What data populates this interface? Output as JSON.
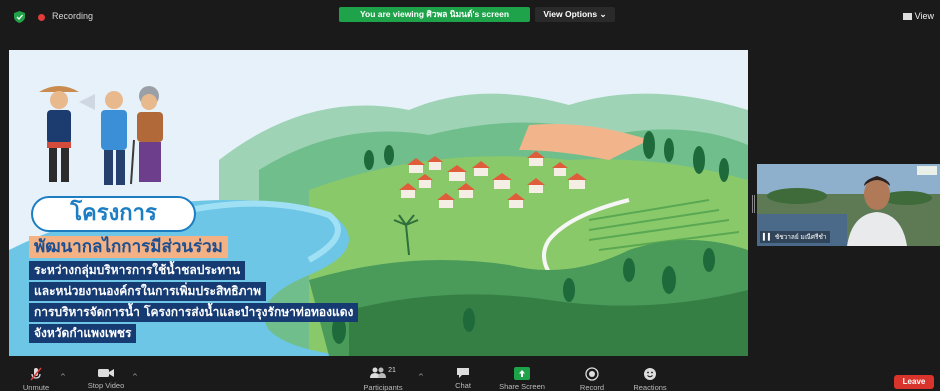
{
  "top_bar": {
    "recording_label": "Recording",
    "viewing_banner": "You are viewing ศิวพล นิมนต์'s screen",
    "view_options_label": "View Options ⌄",
    "view_label": "View"
  },
  "slide": {
    "title": "โครงการ",
    "subtitle": "พัฒนากลไกการมีส่วนร่วม",
    "lines": [
      "ระหว่างกลุ่มบริหารการใช้น้ำชลประทาน",
      "และหน่วยงานองค์กรในการเพิ่มประสิทธิภาพ",
      "การบริหารจัดการน้ำ โครงการส่งน้ำและบำรุงรักษาท่อทองแดง",
      "จังหวัดกำแพงเพชร"
    ]
  },
  "participant": {
    "name": "ชัชวาลย์ มณีศรีชำ"
  },
  "toolbar": {
    "unmute_label": "Unmute",
    "stop_video_label": "Stop Video",
    "participants_label": "Participants",
    "participants_count": "21",
    "chat_label": "Chat",
    "share_screen_label": "Share Screen",
    "record_label": "Record",
    "reactions_label": "Reactions",
    "leave_label": "Leave"
  },
  "colors": {
    "share_green": "#1fa34a",
    "leave_red": "#d9342b",
    "title_blue": "#1d7dc3",
    "navy_band": "#163b73",
    "orange_band": "#f4b183"
  }
}
